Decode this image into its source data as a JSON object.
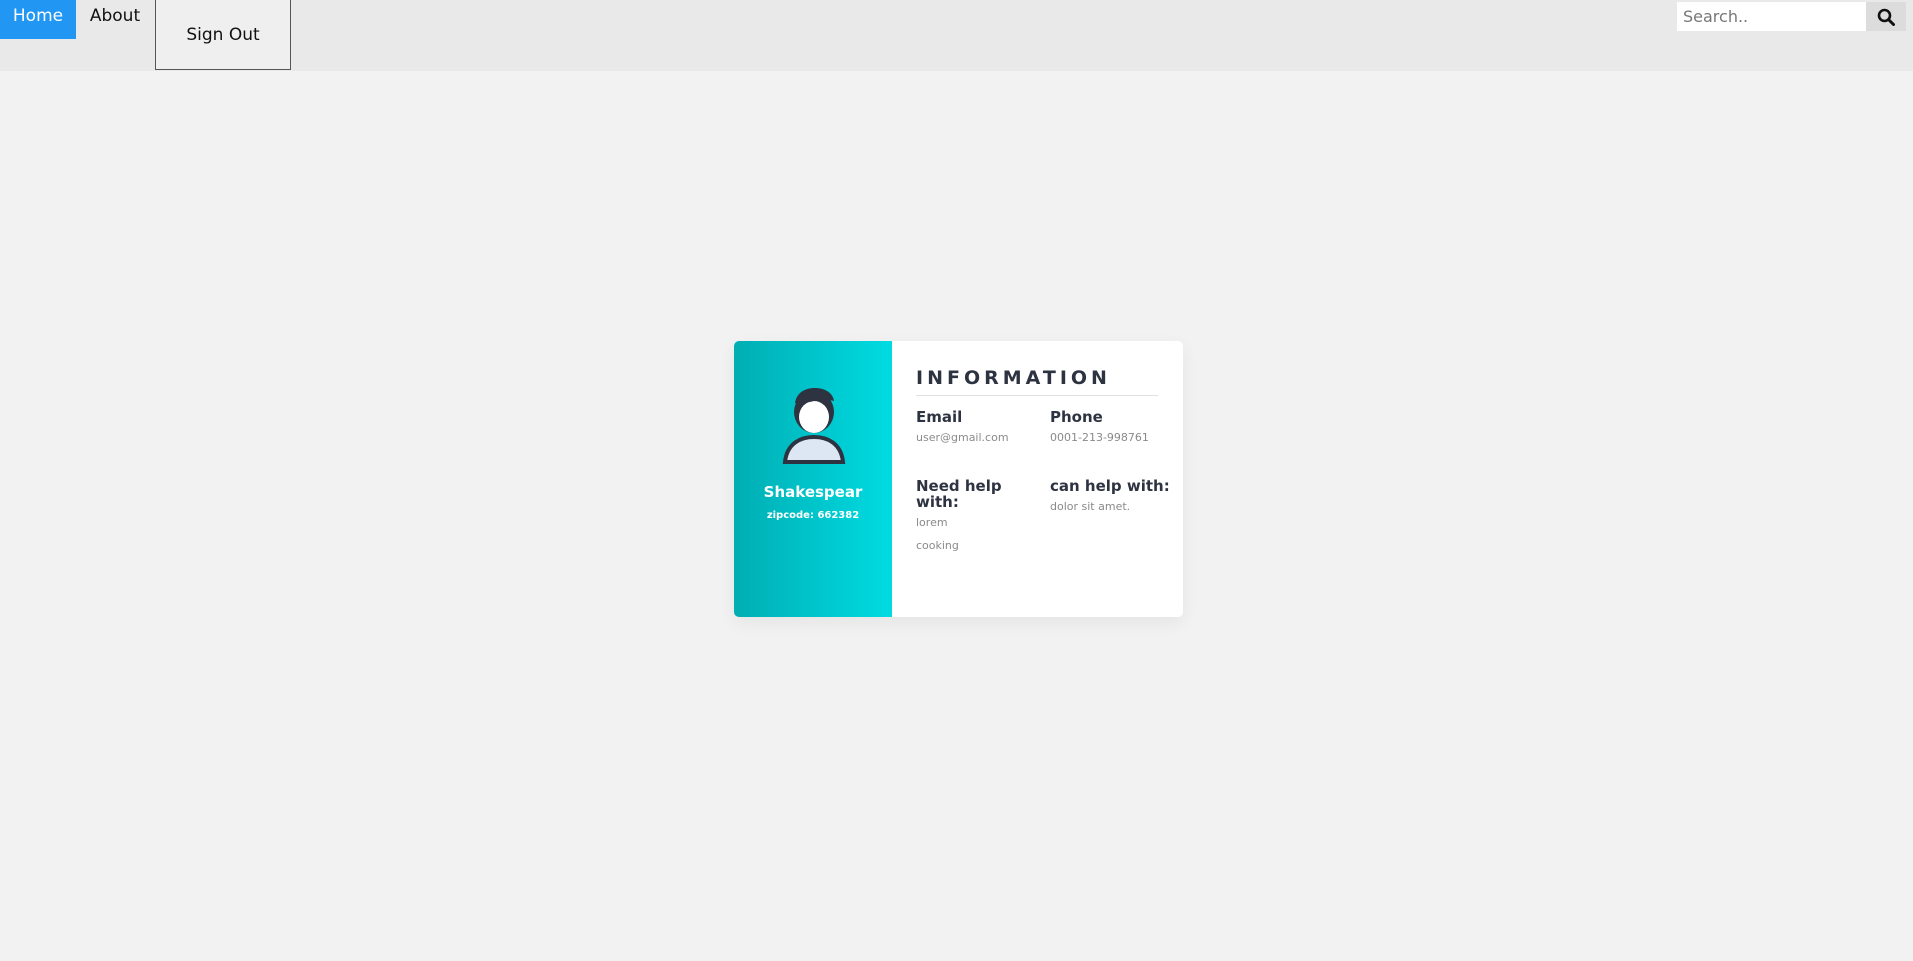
{
  "nav": {
    "home_label": "Home",
    "about_label": "About",
    "signout_label": "Sign Out",
    "search_placeholder": "Search..",
    "search_icon": "search-icon",
    "active_color": "#2196f3"
  },
  "profile": {
    "avatar_icon": "user-avatar-icon",
    "name": "Shakespear",
    "zipcode": "zipcode: 662382",
    "gradient_start": "#00aeb3",
    "gradient_end": "#00dbe2"
  },
  "information": {
    "title": "INFORMATION",
    "email": {
      "label": "Email",
      "value": "user@gmail.com"
    },
    "phone": {
      "label": "Phone",
      "value": "0001-213-998761"
    },
    "need_help": {
      "label": "Need help with:",
      "values": [
        "lorem",
        "cooking"
      ]
    },
    "can_help": {
      "label": "can help with:",
      "value": "dolor sit amet."
    }
  }
}
